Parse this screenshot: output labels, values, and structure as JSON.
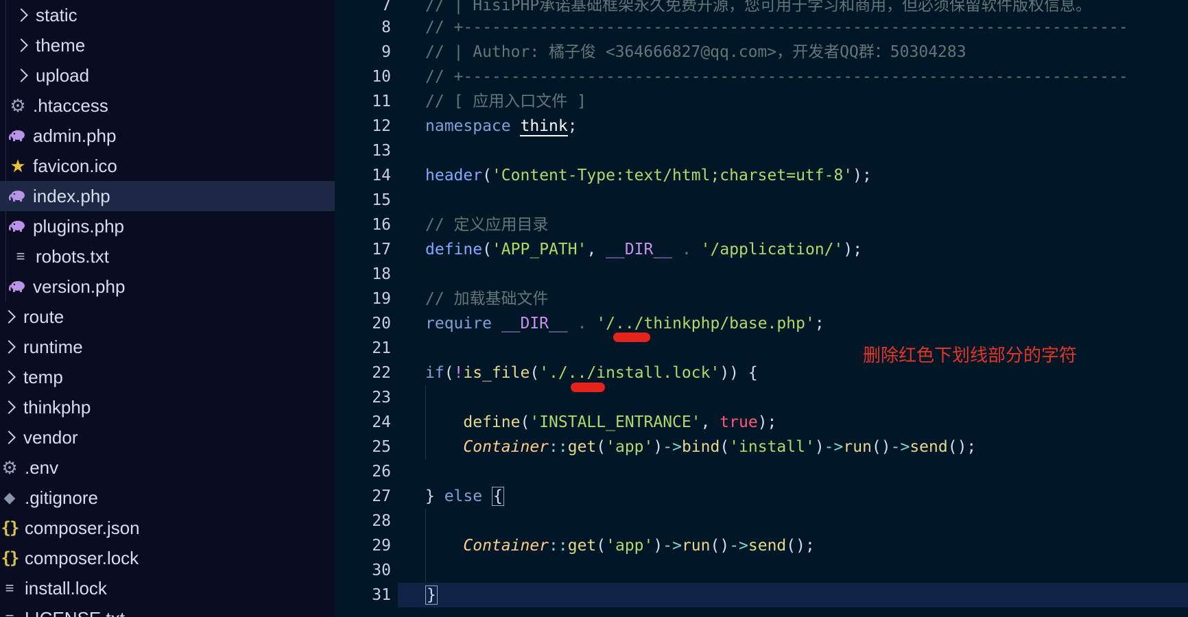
{
  "sidebar": {
    "items": [
      {
        "label": "static",
        "kind": "folder",
        "icon": "chevron-right-icon"
      },
      {
        "label": "theme",
        "kind": "folder",
        "icon": "chevron-right-icon"
      },
      {
        "label": "upload",
        "kind": "folder",
        "icon": "chevron-right-icon"
      },
      {
        "label": ".htaccess",
        "kind": "file",
        "icon": "gear-icon"
      },
      {
        "label": "admin.php",
        "kind": "file",
        "icon": "php-elephant-icon"
      },
      {
        "label": "favicon.ico",
        "kind": "file",
        "icon": "star-icon"
      },
      {
        "label": "index.php",
        "kind": "file",
        "icon": "php-elephant-icon",
        "selected": true
      },
      {
        "label": "plugins.php",
        "kind": "file",
        "icon": "php-elephant-icon"
      },
      {
        "label": "robots.txt",
        "kind": "file",
        "icon": "text-lines-icon"
      },
      {
        "label": "version.php",
        "kind": "file",
        "icon": "php-elephant-icon"
      },
      {
        "label": "route",
        "kind": "folder",
        "icon": "chevron-right-icon"
      },
      {
        "label": "runtime",
        "kind": "folder",
        "icon": "chevron-right-icon"
      },
      {
        "label": "temp",
        "kind": "folder",
        "icon": "chevron-right-icon"
      },
      {
        "label": "thinkphp",
        "kind": "folder",
        "icon": "chevron-right-icon"
      },
      {
        "label": "vendor",
        "kind": "folder",
        "icon": "chevron-right-icon"
      },
      {
        "label": ".env",
        "kind": "file",
        "icon": "gear-icon"
      },
      {
        "label": ".gitignore",
        "kind": "file",
        "icon": "git-icon"
      },
      {
        "label": "composer.json",
        "kind": "file",
        "icon": "braces-icon"
      },
      {
        "label": "composer.lock",
        "kind": "file",
        "icon": "braces-icon"
      },
      {
        "label": "install.lock",
        "kind": "file",
        "icon": "text-lines-icon"
      },
      {
        "label": "LICENSE.txt",
        "kind": "file",
        "icon": "text-lines-icon"
      }
    ]
  },
  "editor": {
    "line_numbers": [
      "7",
      "8",
      "9",
      "10",
      "11",
      "12",
      "13",
      "14",
      "15",
      "16",
      "17",
      "18",
      "19",
      "20",
      "21",
      "22",
      "23",
      "24",
      "25",
      "26",
      "27",
      "28",
      "29",
      "30",
      "31"
    ],
    "lines": {
      "l7": "// | HisiPHP承诺基础框架永久免费开源，您可用于学习和商用，但必须保留软件版权信息。",
      "l8": "// +----------------------------------------------------------------------",
      "l9": "// | Author: 橘子俊 <364666827@qq.com>，开发者QQ群：50304283",
      "l10": "// +----------------------------------------------------------------------",
      "l11": "// [ 应用入口文件 ]",
      "l12_kw": "namespace",
      "l12_ns": "think",
      "l12_end": ";",
      "l14_fn": "header",
      "l14_str": "'Content-Type:text/html;charset=utf-8'",
      "l16": "// 定义应用目录",
      "l17_fn": "define",
      "l17_str1": "'APP_PATH'",
      "l17_const": "__DIR__",
      "l17_str2": "'/application/'",
      "l19": "// 加载基础文件",
      "l20_kw": "require",
      "l20_const": "__DIR__",
      "l20_str": "'/../thinkphp/base.php'",
      "l22_kw": "if",
      "l22_fn": "is_file",
      "l22_str": "'./../install.lock'",
      "l24_fn": "define",
      "l24_str": "'INSTALL_ENTRANCE'",
      "l24_true": "true",
      "l25_class": "Container",
      "l25_get": "get",
      "l25_app": "'app'",
      "l25_bind": "bind",
      "l25_install": "'install'",
      "l25_run": "run",
      "l25_send": "send",
      "l27_else": "else",
      "l29_class": "Container",
      "l29_get": "get",
      "l29_app": "'app'",
      "l29_run": "run",
      "l29_send": "send"
    }
  },
  "annotation": {
    "text": "删除红色下划线部分的字符",
    "color": "#e53526"
  },
  "colors": {
    "sidebar_bg": "#0a0d22",
    "editor_bg": "#011627",
    "selected_row": "#1d2944",
    "current_line": "#0e2447",
    "red_mark": "#e3241a"
  }
}
